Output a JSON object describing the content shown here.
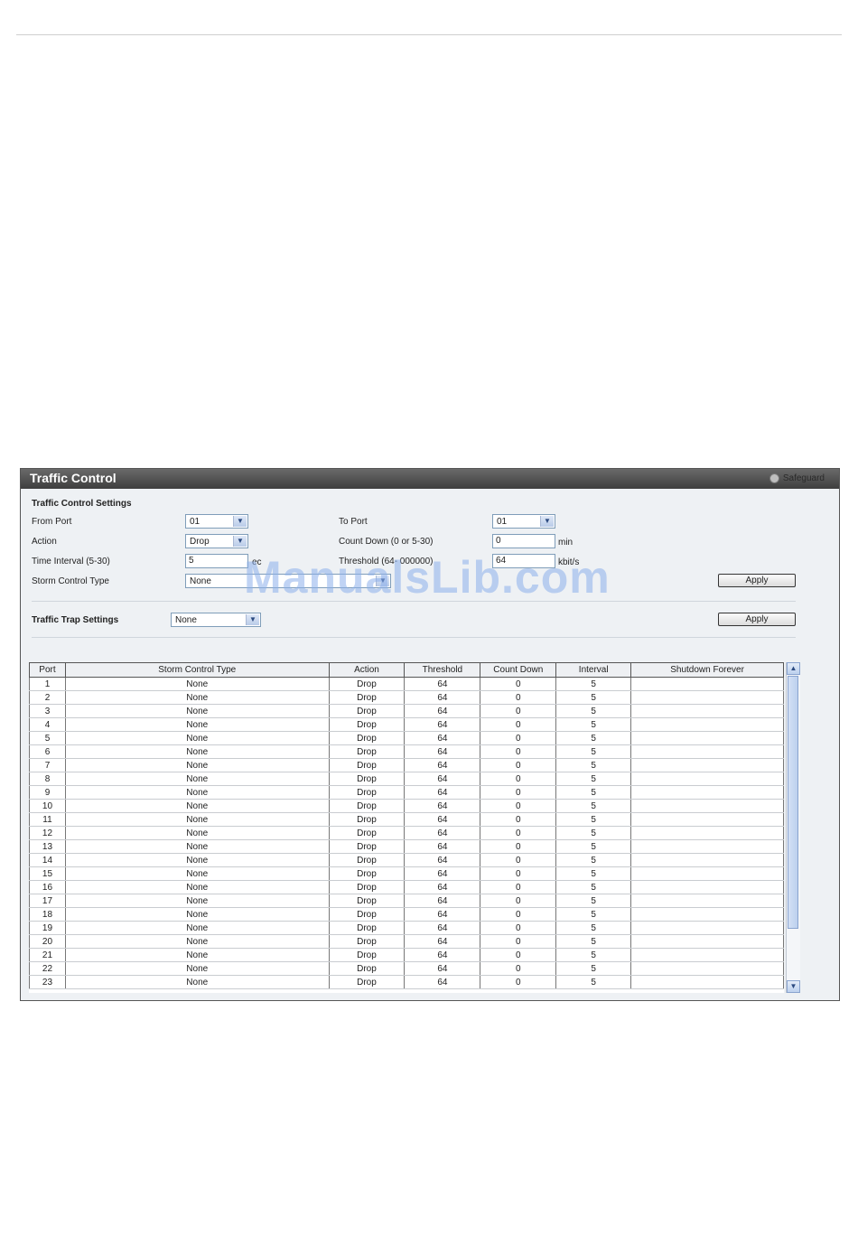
{
  "panel": {
    "title": "Traffic Control",
    "safeguard_label": "Safeguard"
  },
  "settings": {
    "section_title": "Traffic Control Settings",
    "from_port_label": "From Port",
    "from_port_value": "01",
    "to_port_label": "To Port",
    "to_port_value": "01",
    "action_label": "Action",
    "action_value": "Drop",
    "count_down_label": "Count Down (0 or 5-30)",
    "count_down_value": "0",
    "count_down_unit": "min",
    "time_interval_label": "Time Interval (5-30)",
    "time_interval_value": "5",
    "time_interval_unit": "ec",
    "threshold_label": "Threshold (64- 000000)",
    "threshold_value": "64",
    "threshold_unit": "kbit/s",
    "storm_type_label": "Storm Control Type",
    "storm_type_value": "None",
    "apply_label": "Apply"
  },
  "trap": {
    "label": "Traffic Trap Settings",
    "value": "None",
    "apply_label": "Apply"
  },
  "watermark": "ManualsLib.com",
  "table": {
    "headers": [
      "Port",
      "Storm Control Type",
      "Action",
      "Threshold",
      "Count Down",
      "Interval",
      "Shutdown Forever"
    ],
    "rows": [
      [
        "1",
        "None",
        "Drop",
        "64",
        "0",
        "5",
        ""
      ],
      [
        "2",
        "None",
        "Drop",
        "64",
        "0",
        "5",
        ""
      ],
      [
        "3",
        "None",
        "Drop",
        "64",
        "0",
        "5",
        ""
      ],
      [
        "4",
        "None",
        "Drop",
        "64",
        "0",
        "5",
        ""
      ],
      [
        "5",
        "None",
        "Drop",
        "64",
        "0",
        "5",
        ""
      ],
      [
        "6",
        "None",
        "Drop",
        "64",
        "0",
        "5",
        ""
      ],
      [
        "7",
        "None",
        "Drop",
        "64",
        "0",
        "5",
        ""
      ],
      [
        "8",
        "None",
        "Drop",
        "64",
        "0",
        "5",
        ""
      ],
      [
        "9",
        "None",
        "Drop",
        "64",
        "0",
        "5",
        ""
      ],
      [
        "10",
        "None",
        "Drop",
        "64",
        "0",
        "5",
        ""
      ],
      [
        "11",
        "None",
        "Drop",
        "64",
        "0",
        "5",
        ""
      ],
      [
        "12",
        "None",
        "Drop",
        "64",
        "0",
        "5",
        ""
      ],
      [
        "13",
        "None",
        "Drop",
        "64",
        "0",
        "5",
        ""
      ],
      [
        "14",
        "None",
        "Drop",
        "64",
        "0",
        "5",
        ""
      ],
      [
        "15",
        "None",
        "Drop",
        "64",
        "0",
        "5",
        ""
      ],
      [
        "16",
        "None",
        "Drop",
        "64",
        "0",
        "5",
        ""
      ],
      [
        "17",
        "None",
        "Drop",
        "64",
        "0",
        "5",
        ""
      ],
      [
        "18",
        "None",
        "Drop",
        "64",
        "0",
        "5",
        ""
      ],
      [
        "19",
        "None",
        "Drop",
        "64",
        "0",
        "5",
        ""
      ],
      [
        "20",
        "None",
        "Drop",
        "64",
        "0",
        "5",
        ""
      ],
      [
        "21",
        "None",
        "Drop",
        "64",
        "0",
        "5",
        ""
      ],
      [
        "22",
        "None",
        "Drop",
        "64",
        "0",
        "5",
        ""
      ],
      [
        "23",
        "None",
        "Drop",
        "64",
        "0",
        "5",
        ""
      ]
    ]
  },
  "icons": {
    "dropdown": "chevron-down-icon",
    "scroll_up": "arrow-up-icon",
    "scroll_down": "arrow-down-icon",
    "status": "status-dot-icon"
  }
}
